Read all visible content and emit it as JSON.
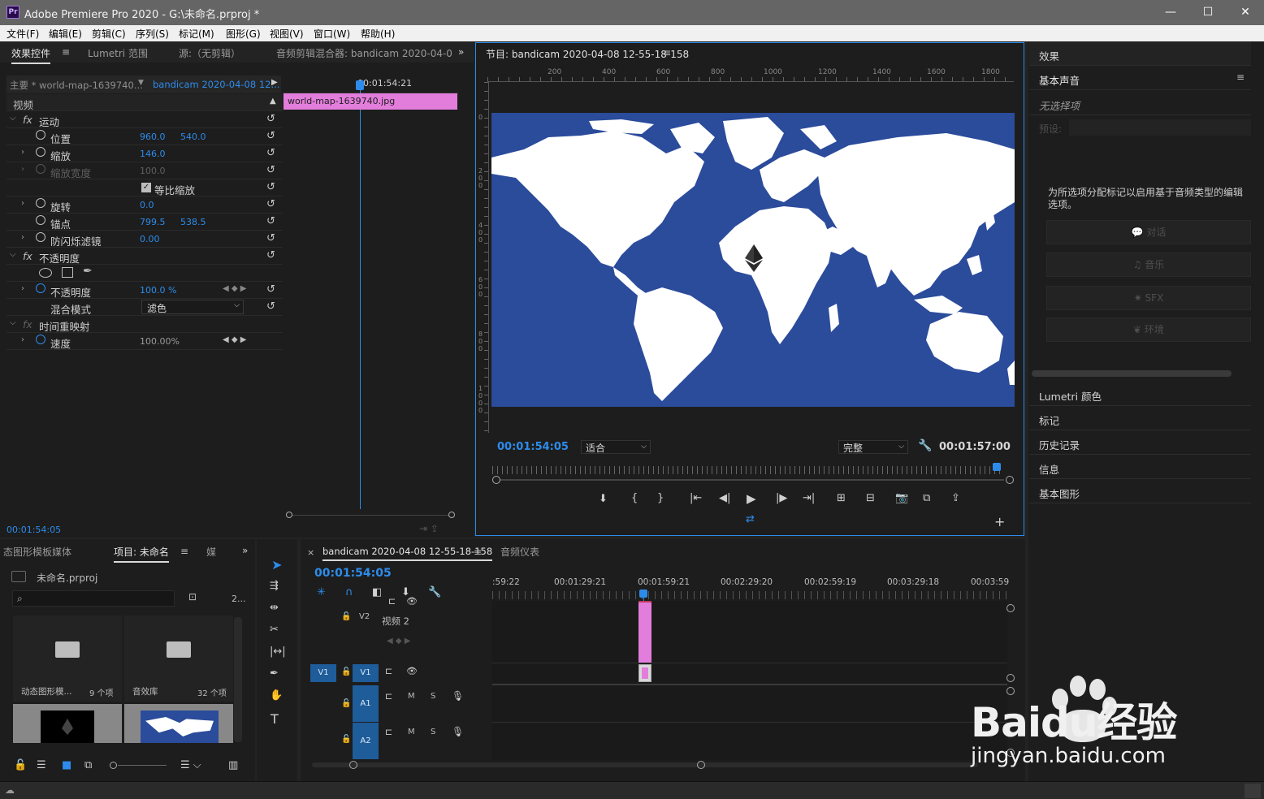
{
  "window": {
    "title": "Adobe Premiere Pro 2020 - G:\\未命名.prproj *",
    "app_badge": "Pr",
    "min": "—",
    "max": "☐",
    "close": "✕"
  },
  "menu": [
    "文件(F)",
    "编辑(E)",
    "剪辑(C)",
    "序列(S)",
    "标记(M)",
    "图形(G)",
    "视图(V)",
    "窗口(W)",
    "帮助(H)"
  ],
  "effect_panel": {
    "tabs": [
      "效果控件",
      "Lumetri 范围",
      "源:（无剪辑）",
      "音频剪辑混合器: bandicam 2020-04-0"
    ],
    "master": "主要 * world-map-1639740...",
    "sequence": "bandicam 2020-04-08 12...",
    "ruler_time": "00:01:54:21",
    "clip_name": "world-map-1639740.jpg",
    "section": "视频",
    "motion": "运动",
    "position": {
      "label": "位置",
      "x": "960.0",
      "y": "540.0"
    },
    "scale": {
      "label": "缩放",
      "value": "146.0"
    },
    "scale_width": {
      "label": "缩放宽度",
      "value": "100.0"
    },
    "uniform": "等比缩放",
    "rotation": {
      "label": "旋转",
      "value": "0.0"
    },
    "anchor": {
      "label": "锚点",
      "x": "799.5",
      "y": "538.5"
    },
    "flicker": {
      "label": "防闪烁滤镜",
      "value": "0.00"
    },
    "opacity_group": "不透明度",
    "opacity": {
      "label": "不透明度",
      "value": "100.0 %"
    },
    "blend": {
      "label": "混合模式",
      "value": "滤色"
    },
    "time_remap": "时间重映射",
    "speed": {
      "label": "速度",
      "value": "100.00%"
    },
    "footer_time": "00:01:54:05"
  },
  "program": {
    "title": "节目: bandicam 2020-04-08 12-55-18-158",
    "ruler": [
      "200",
      "400",
      "600",
      "800",
      "1000",
      "1200",
      "1400",
      "1600",
      "1800"
    ],
    "vruler": [
      "0",
      "2 0 0",
      "4 0 0",
      "6 0 0",
      "8 0 0",
      "1 0 0 0"
    ],
    "current_time": "00:01:54:05",
    "fit": "适合",
    "quality": "完整",
    "duration": "00:01:57:00"
  },
  "right_panel": {
    "effects": "效果",
    "essential_sound": "基本声音",
    "no_selection": "无选择项",
    "preset": "预设:",
    "hint": "为所选项分配标记以启用基于音频类型的编辑选项。",
    "buttons": [
      "对话",
      "音乐",
      "SFX",
      "环境"
    ],
    "sections": [
      "Lumetri 颜色",
      "标记",
      "历史记录",
      "信息",
      "基本图形"
    ]
  },
  "project": {
    "tabs": [
      "态图形模板媒体",
      "项目: 未命名",
      "媒"
    ],
    "file": "未命名.prproj",
    "count": "2...",
    "bins": [
      {
        "name": "动态图形模...",
        "count": "9 个项"
      },
      {
        "name": "音效库",
        "count": "32 个项"
      }
    ]
  },
  "timeline": {
    "tab": "bandicam 2020-04-08 12-55-18-158",
    "tab2": "音频仪表",
    "close": "×",
    "timecode": "00:01:54:05",
    "ruler": [
      ":59:22",
      "00:01:29:21",
      "00:01:59:21",
      "00:02:29:20",
      "00:02:59:19",
      "00:03:29:18",
      "00:03:59"
    ],
    "tracks": {
      "v2": "V2",
      "v2_name": "视频 2",
      "v1": "V1",
      "a1": "A1",
      "a2": "A2",
      "m": "M",
      "s": "S"
    }
  },
  "watermark": {
    "brand": "Baidu经验",
    "url": "jingyan.baidu.com"
  }
}
